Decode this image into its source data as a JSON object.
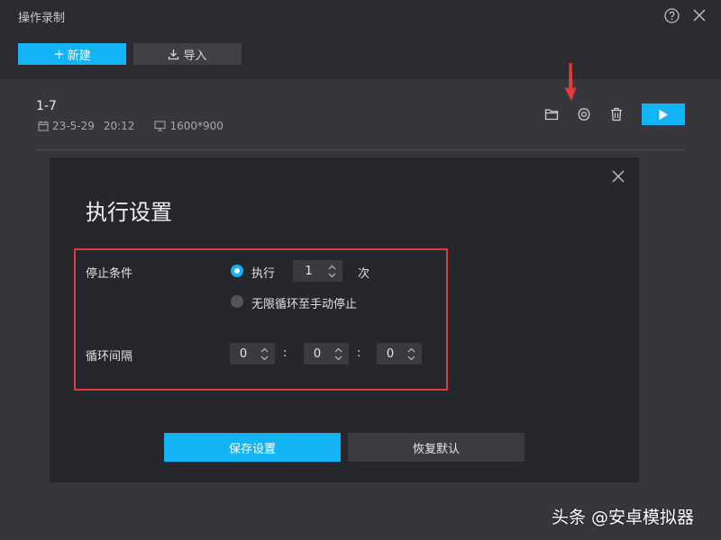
{
  "window": {
    "title": "操作录制"
  },
  "toolbar": {
    "new_label": "新建",
    "import_label": "导入"
  },
  "recording": {
    "name": "1-7",
    "date": "23-5-29",
    "time": "20:12",
    "resolution": "1600*900"
  },
  "dialog": {
    "title": "执行设置",
    "stop_condition_label": "停止条件",
    "execute_label": "执行",
    "execute_count": "1",
    "count_unit": "次",
    "infinite_label": "无限循环至手动停止",
    "loop_interval_label": "循环间隔",
    "interval_hours": "0",
    "interval_minutes": "0",
    "interval_seconds": "0",
    "separator": ":",
    "save_label": "保存设置",
    "reset_label": "恢复默认"
  },
  "watermark": {
    "text": "头条 @安卓模拟器"
  },
  "colors": {
    "accent": "#12b4f5",
    "highlight": "#e23b3b"
  },
  "icons": [
    "help-icon",
    "close-icon",
    "plus-icon",
    "download-icon",
    "calendar-icon",
    "monitor-icon",
    "folder-icon",
    "gear-icon",
    "trash-icon",
    "play-icon",
    "chevron-up-down-icon"
  ]
}
